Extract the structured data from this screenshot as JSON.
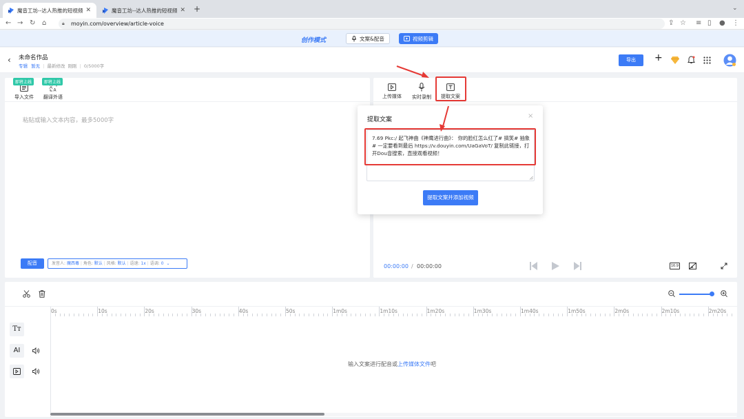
{
  "browser": {
    "tabs": [
      {
        "title": "魔音工坊--达人热推的短视频/有声书/…",
        "active": true
      },
      {
        "title": "魔音工坊--达人热推的短视频/有声书/…",
        "active": false
      }
    ],
    "new_tab": "+",
    "url": "moyin.com/overview/article-voice"
  },
  "modebar": {
    "title": "创作模式",
    "btn_voice": "文案&配音",
    "btn_video": "视频剪辑"
  },
  "header": {
    "doc_title": "未命名作品",
    "tag1": "专辑",
    "tag2": "暂无",
    "last_modified": "最新修改",
    "modified_time": "刚刚",
    "word_count": "0/5000字",
    "export": "导出"
  },
  "left_panel": {
    "import_badge": "即将上线",
    "import_label": "导入文件",
    "translate_badge": "即将上线",
    "translate_label": "翻译外语",
    "placeholder": "粘贴或输入文本内容，最多5000字",
    "dub_button": "配音",
    "voice_bar": {
      "speaker_label": "发音人:",
      "speaker": "魔西毒",
      "role_label": "角色:",
      "role": "默认",
      "style_label": "风格:",
      "style": "默认",
      "speed_label": "语速:",
      "speed": "1x",
      "pitch_label": "语调:",
      "pitch": "0"
    }
  },
  "right_panel": {
    "upload_label": "上传媒体",
    "record_label": "实时录制",
    "extract_label": "提取文案",
    "time_current": "00:00:00",
    "time_sep": "/",
    "time_total": "00:00:00",
    "ratio": "16:9"
  },
  "modal": {
    "title": "提取文案",
    "close": "×",
    "text": "7.69 Pkc:/ 起飞神曲《神鹰进行曲》：  你的脸红怎么红了# 搞笑# 抽象 # 一定要看到最后  https://v.douyin.com/UaGaVoT/ 复制此链接，打开Dou音搜索，直接观看视频！",
    "submit": "提取文案并添加视频"
  },
  "timeline": {
    "ruler": [
      "0s",
      "10s",
      "20s",
      "30s",
      "40s",
      "50s",
      "1m0s",
      "1m10s",
      "1m20s",
      "1m30s",
      "1m40s",
      "1m50s",
      "2m0s",
      "2m10s",
      "2m20s"
    ],
    "track_text_icon": "Tт",
    "track_ai_label": "AI",
    "empty_prefix": "输入文案进行配音或",
    "empty_link": "上传媒体文件",
    "empty_suffix": "吧",
    "zoom_level": 0.95
  },
  "colors": {
    "accent": "#3c7bf6",
    "highlight": "#e53935",
    "badge": "#2fc8a8"
  }
}
